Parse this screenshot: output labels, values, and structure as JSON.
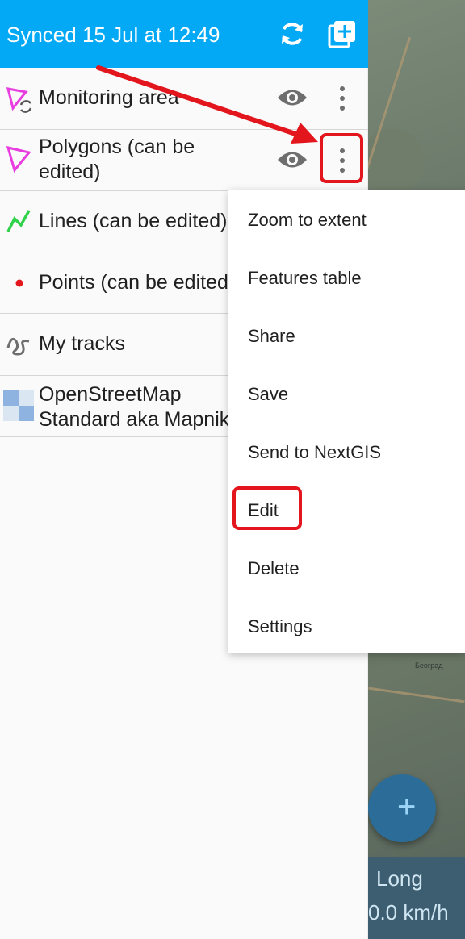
{
  "header": {
    "sync_status": "Synced 15 Jul at 12:49",
    "refresh_icon": "refresh-icon",
    "add_layer_icon": "add-layer-icon"
  },
  "layers": [
    {
      "label": "Monitoring area",
      "icon": "polygon-sync-icon"
    },
    {
      "label": "Polygons (can be edited)",
      "line1": "Polygons (can be",
      "line2": "edited)",
      "icon": "polygon-icon"
    },
    {
      "label": "Lines (can be edited)",
      "icon": "line-icon"
    },
    {
      "label": "Points (can be edited)",
      "icon": "point-icon"
    },
    {
      "label": "My tracks",
      "icon": "track-icon"
    },
    {
      "label": "OpenStreetMap Standard aka Mapnik",
      "line1": "OpenStreetMap",
      "line2": "Standard aka Mapnik",
      "icon": "tile-layer-icon"
    }
  ],
  "menu": {
    "items": [
      "Zoom to extent",
      "Features table",
      "Share",
      "Save",
      "Send to NextGIS",
      "Edit",
      "Delete",
      "Settings"
    ]
  },
  "map": {
    "fab_symbol": "+",
    "speed_label": "Long",
    "speed_value": "0.0 km/h",
    "city_label": "Београд"
  },
  "colors": {
    "header": "#03a9f4",
    "highlight": "#e3151d",
    "polygon": "#e83ce0",
    "line": "#2fd24a",
    "point": "#e3151d"
  }
}
